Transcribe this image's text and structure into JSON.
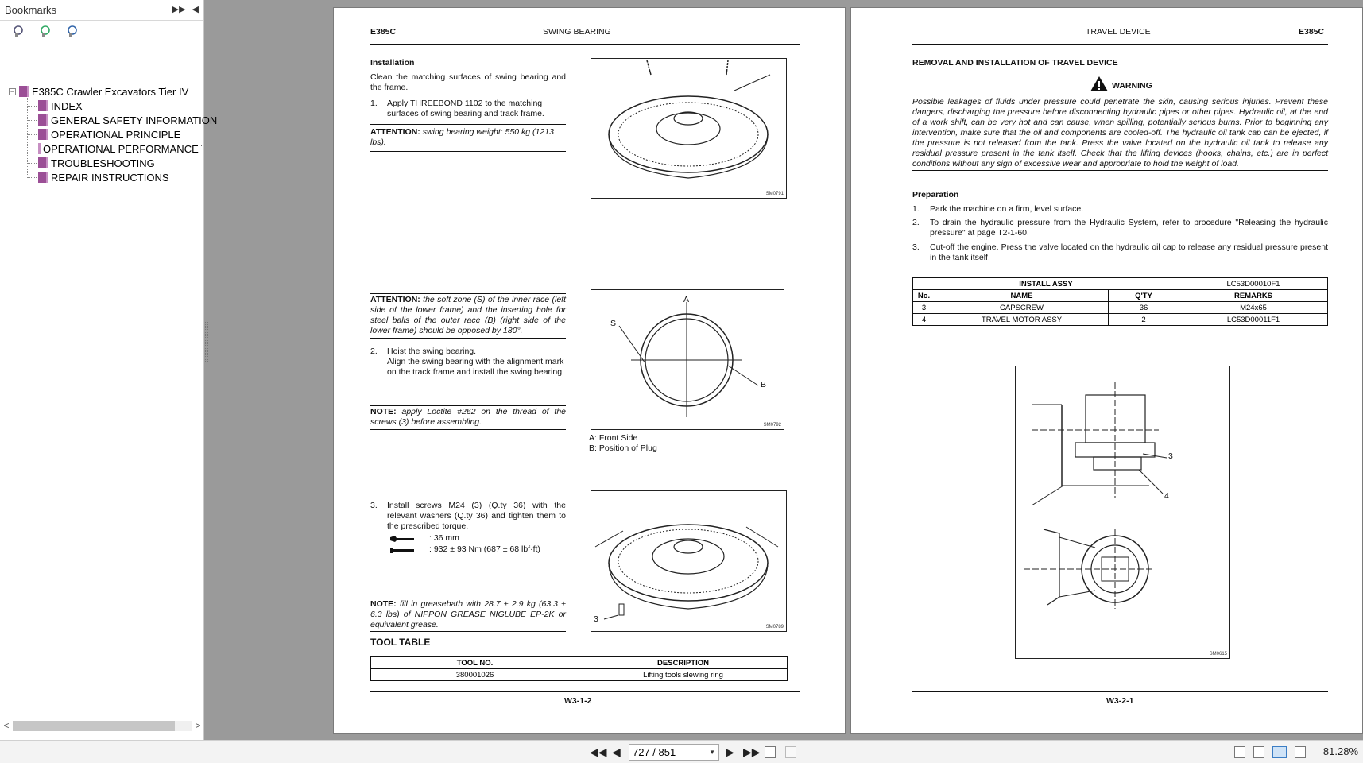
{
  "sidebar": {
    "title": "Bookmarks",
    "root": "E385C Crawler Excavators Tier IV",
    "items": [
      {
        "label": "INDEX"
      },
      {
        "label": "GENERAL SAFETY INFORMATION"
      },
      {
        "label": "OPERATIONAL PRINCIPLE"
      },
      {
        "label": "OPERATIONAL PERFORMANCE TES"
      },
      {
        "label": "TROUBLESHOOTING"
      },
      {
        "label": "REPAIR INSTRUCTIONS"
      }
    ]
  },
  "left_page": {
    "model": "E385C",
    "section": "SWING BEARING",
    "installation_heading": "Installation",
    "intro": "Clean the matching surfaces of swing bearing and the frame.",
    "step1_num": "1.",
    "step1": "Apply THREEBOND 1102 to the matching surfaces of swing bearing and track frame.",
    "attention1_label": "ATTENTION:",
    "attention1": "swing bearing weight: 550 kg (1213 lbs).",
    "attention2_label": "ATTENTION:",
    "attention2": "the soft zone (S) of the inner race (left side of the lower frame) and the inserting hole for steel balls of the outer race (B) (right side of the lower frame) should be opposed by 180°.",
    "step2_num": "2.",
    "step2a": "Hoist the swing bearing.",
    "step2b": "Align the swing bearing with the alignment mark on the track frame and install the swing bearing.",
    "note1_label": "NOTE:",
    "note1": "apply Loctite #262 on the thread of the screws (3) before assembling.",
    "step3_num": "3.",
    "step3": "Install screws M24 (3) (Q.ty 36) with the relevant washers (Q.ty 36) and tighten them to the prescribed torque.",
    "wrench_value": ": 36 mm",
    "torque_value": ": 932 ± 93 Nm (687 ± 68 lbf·ft)",
    "note2_label": "NOTE:",
    "note2": "fill in greasebath with 28.7 ± 2.9 kg (63.3 ± 6.3 lbs) of NIPPON GREASE NIGLUBE EP-2K or equivalent grease.",
    "fig1_code": "SM0791",
    "fig2_code": "SM0792",
    "fig3_code": "SM0789",
    "fig2_label_a": "A",
    "fig2_label_s": "S",
    "fig2_label_b": "B",
    "fig3_label": "3",
    "legend_a": "A: Front Side",
    "legend_b": "B: Position of Plug",
    "tool_table_title": "TOOL TABLE",
    "tool_table_headers": [
      "TOOL NO.",
      "DESCRIPTION"
    ],
    "tool_table_rows": [
      [
        "380001026",
        "Lifting tools slewing ring"
      ]
    ],
    "page_number": "W3-1-2"
  },
  "right_page": {
    "section": "TRAVEL DEVICE",
    "model": "E385C",
    "heading": "REMOVAL AND INSTALLATION OF TRAVEL DEVICE",
    "warning_title": "WARNING",
    "warning_text": "Possible leakages of fluids under pressure could penetrate the skin, causing serious injuries. Prevent these dangers, discharging the pressure before disconnecting hydraulic pipes or other pipes. Hydraulic oil, at the end of a work shift, can be very hot and can cause, when spilling, potentially serious burns. Prior to beginning any intervention, make sure that the oil and components are cooled-off. The hydraulic oil tank cap can be ejected, if the pressure is not released from the tank. Press the valve located on the hydraulic oil tank to release any residual pressure present in the tank itself. Check that the lifting devices (hooks, chains, etc.) are in perfect conditions without any sign of excessive wear and appropriate to hold the weight of load.",
    "prep_heading": "Preparation",
    "prep_steps": [
      {
        "num": "1.",
        "text": "Park the machine on a firm, level surface."
      },
      {
        "num": "2.",
        "text": "To drain the hydraulic pressure from the Hydraulic System, refer to procedure \"Releasing the hydraulic pressure\" at page T2-1-60."
      },
      {
        "num": "3.",
        "text": "Cut-off the engine. Press the valve located on the hydraulic oil cap to release any residual pressure present in the tank itself."
      }
    ],
    "table_title": "INSTALL ASSY",
    "table_code": "LC53D00010F1",
    "table_headers": [
      "No.",
      "NAME",
      "Q'TY",
      "REMARKS"
    ],
    "table_rows": [
      [
        "3",
        "CAPSCREW",
        "36",
        "M24x65"
      ],
      [
        "4",
        "TRAVEL MOTOR ASSY",
        "2",
        "LC53D00011F1"
      ]
    ],
    "fig_label_3": "3",
    "fig_label_4": "4",
    "fig_code": "SM0615",
    "page_number": "W3-2-1"
  },
  "toolbar": {
    "page_field": "727 / 851",
    "zoom": "81.28%"
  }
}
